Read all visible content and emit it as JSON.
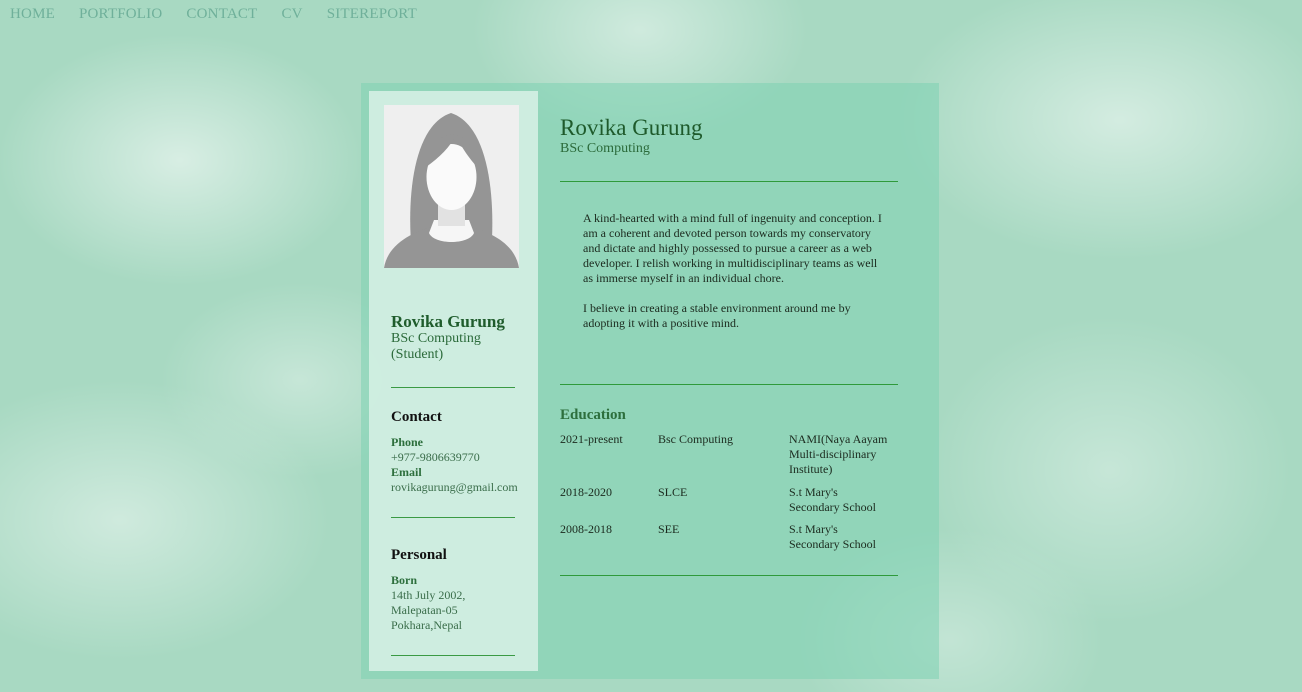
{
  "nav": {
    "items": [
      "HOME",
      "PORTFOLIO",
      "CONTACT",
      "CV",
      "SITEREPORT"
    ]
  },
  "sidebar": {
    "name": "Rovika Gurung",
    "title": "BSc Computing (Student)",
    "contact": {
      "heading": "Contact",
      "phone_label": "Phone",
      "phone": "+977-9806639770",
      "email_label": "Email",
      "email": "rovikagurung@gmail.com"
    },
    "personal": {
      "heading": "Personal",
      "born_label": "Born",
      "born": "14th July 2002, Malepatan-05 Pokhara,Nepal"
    }
  },
  "main": {
    "name": "Rovika Gurung",
    "subtitle": "BSc Computing",
    "about": [
      "A kind-hearted with a mind full of ingenuity and conception. I am a coherent and devoted person towards my conservatory and dictate and highly possessed to pursue a career as a web developer. I relish working in multidisciplinary teams as well as immerse myself in an individual chore.",
      "I believe in creating a stable environment around me by adopting it with a positive mind."
    ],
    "education": {
      "heading": "Education",
      "rows": [
        {
          "years": "2021-present",
          "degree": "Bsc Computing",
          "institution": "NAMI(Naya Aayam Multi-disciplinary Institute)"
        },
        {
          "years": "2018-2020",
          "degree": "SLCE",
          "institution": "S.t Mary's Secondary School"
        },
        {
          "years": "2008-2018",
          "degree": "SEE",
          "institution": "S.t Mary's Secondary School"
        }
      ]
    }
  },
  "colors": {
    "accent": "#1e5a2b",
    "rule": "#2f9a3b",
    "nav_link": "#6fb09a"
  },
  "icons": {
    "profile_photo": "avatar-placeholder-icon"
  }
}
